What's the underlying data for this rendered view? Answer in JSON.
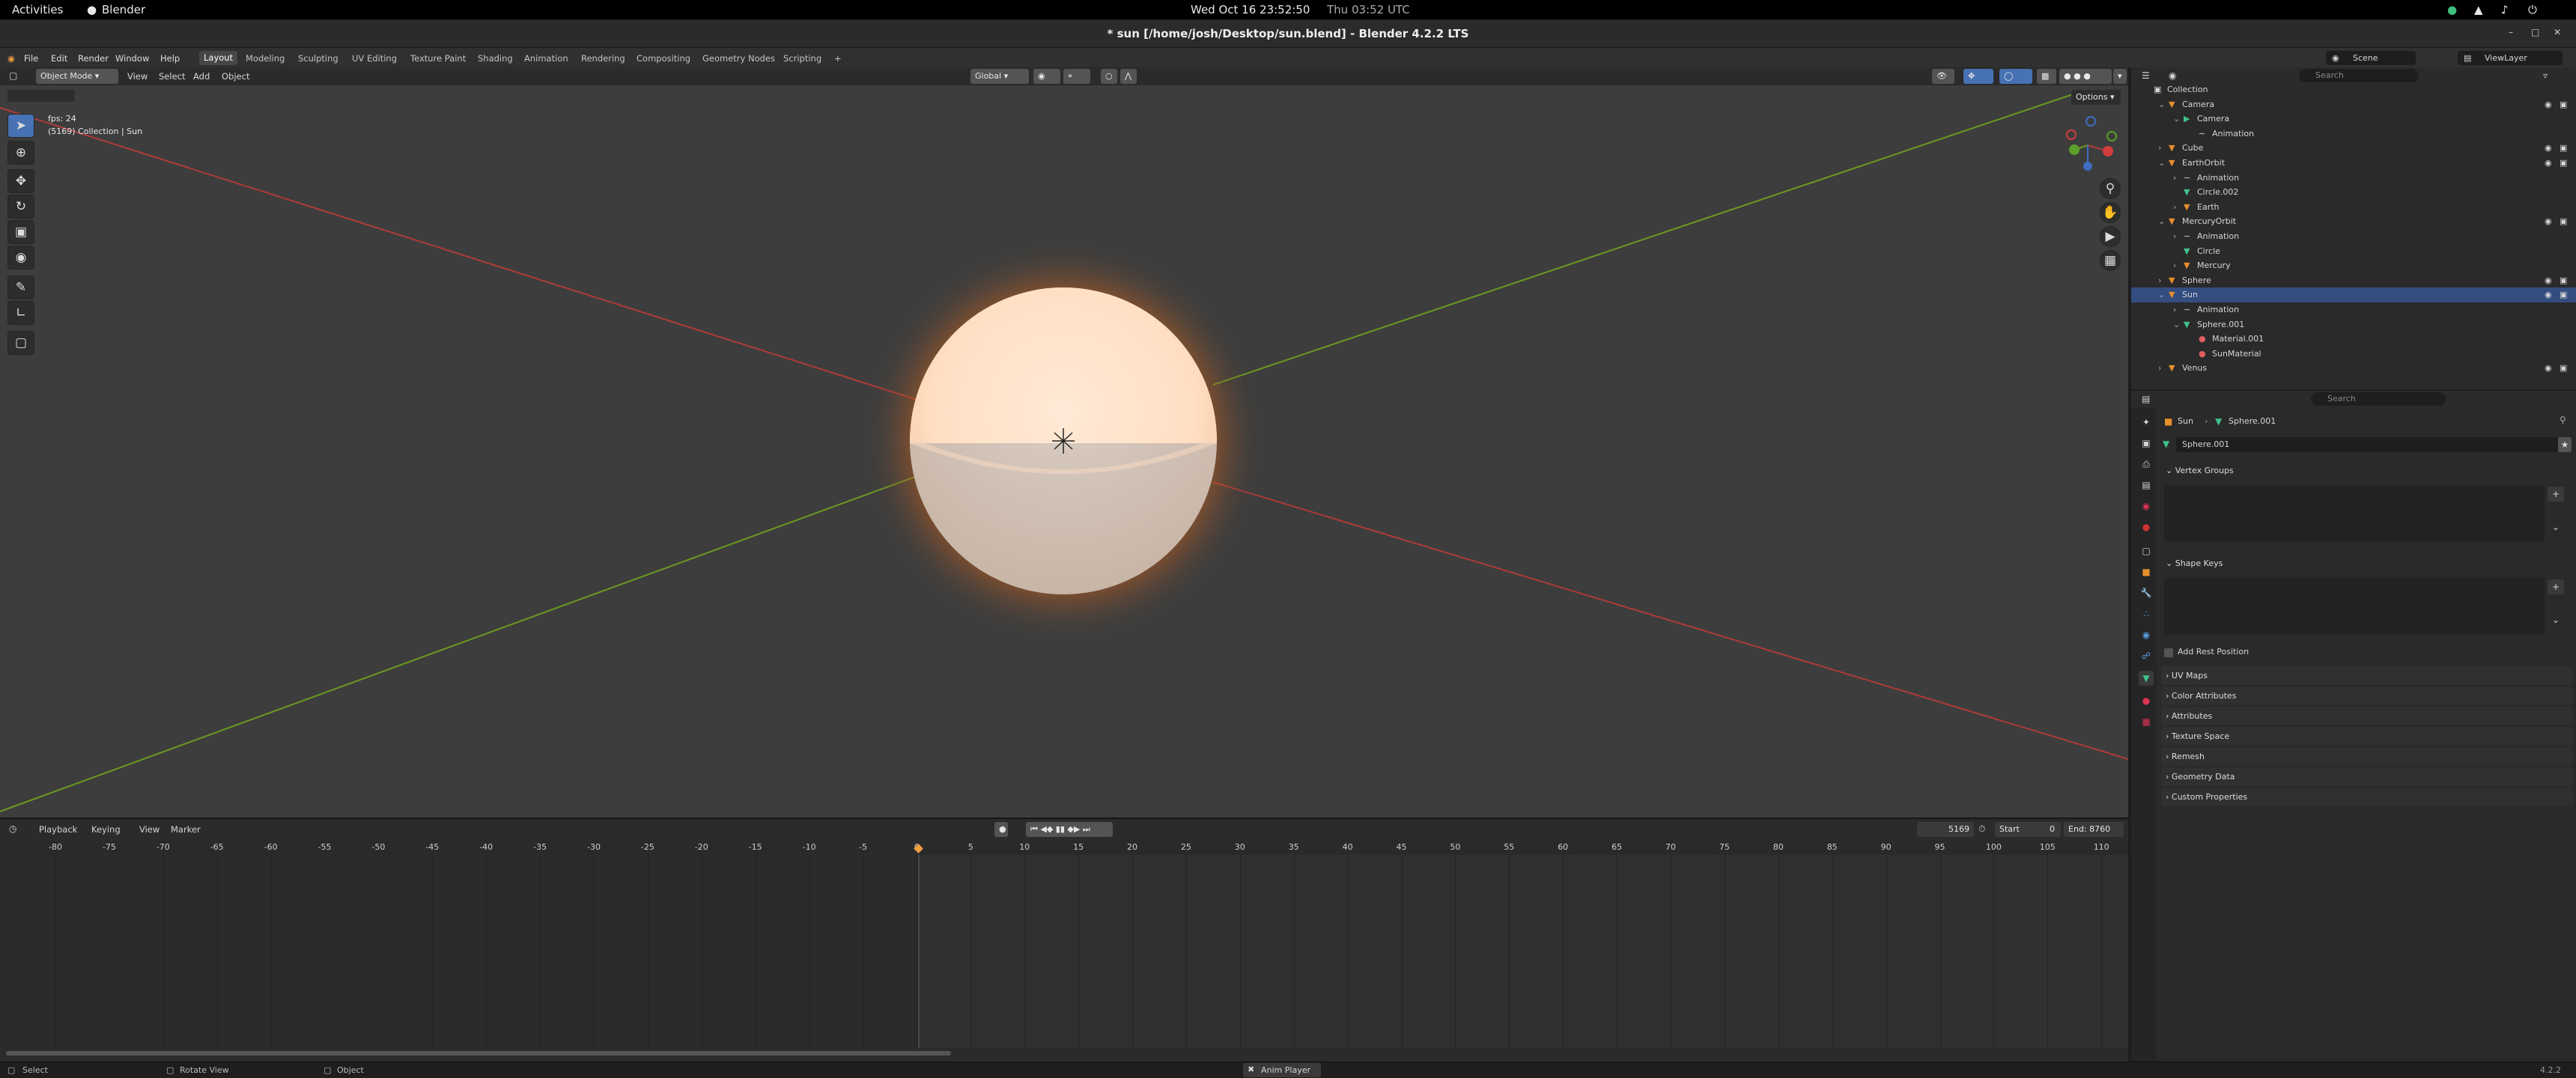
{
  "gnome_bar": {
    "activities": "Activities",
    "app_name": "Blender",
    "datetime": "Wed Oct 16  23:52:50",
    "utc_time": "Thu 03:52 UTC"
  },
  "window": {
    "title": "* sun [/home/josh/Desktop/sun.blend] - Blender 4.2.2 LTS"
  },
  "menu": {
    "items": [
      "File",
      "Edit",
      "Render",
      "Window",
      "Help"
    ],
    "workspaces": [
      "Layout",
      "Modeling",
      "Sculpting",
      "UV Editing",
      "Texture Paint",
      "Shading",
      "Animation",
      "Rendering",
      "Compositing",
      "Geometry Nodes",
      "Scripting"
    ],
    "active_workspace": "Layout",
    "add_workspace": "+",
    "scene": "Scene",
    "view_layer": "ViewLayer"
  },
  "viewport_header": {
    "mode": "Object Mode",
    "menus": [
      "View",
      "Select",
      "Add",
      "Object"
    ],
    "orientation": "Global",
    "options": "Options"
  },
  "viewport": {
    "overlay_line1": "fps: 24",
    "overlay_line2": "(5169) Collection | Sun"
  },
  "outliner": {
    "search_placeholder": "Search",
    "rows": [
      {
        "label": "Collection",
        "indent": 0,
        "type": "collection"
      },
      {
        "label": "Camera",
        "indent": 1,
        "type": "object",
        "expand": "v"
      },
      {
        "label": "Camera",
        "indent": 2,
        "type": "camera",
        "expand": "v"
      },
      {
        "label": "Animation",
        "indent": 3,
        "type": "anim"
      },
      {
        "label": "Cube",
        "indent": 1,
        "type": "object",
        "expand": ">"
      },
      {
        "label": "EarthOrbit",
        "indent": 1,
        "type": "object",
        "expand": "v"
      },
      {
        "label": "Animation",
        "indent": 2,
        "type": "anim",
        "expand": ">"
      },
      {
        "label": "Circle.002",
        "indent": 2,
        "type": "mesh"
      },
      {
        "label": "Earth",
        "indent": 2,
        "type": "object",
        "expand": ">"
      },
      {
        "label": "MercuryOrbit",
        "indent": 1,
        "type": "object",
        "expand": "v"
      },
      {
        "label": "Animation",
        "indent": 2,
        "type": "anim",
        "expand": ">"
      },
      {
        "label": "Circle",
        "indent": 2,
        "type": "mesh"
      },
      {
        "label": "Mercury",
        "indent": 2,
        "type": "object",
        "expand": ">"
      },
      {
        "label": "Sphere",
        "indent": 1,
        "type": "object",
        "expand": ">"
      },
      {
        "label": "Sun",
        "indent": 1,
        "type": "object",
        "expand": "v",
        "selected": true
      },
      {
        "label": "Animation",
        "indent": 2,
        "type": "anim",
        "expand": ">"
      },
      {
        "label": "Sphere.001",
        "indent": 2,
        "type": "mesh",
        "expand": "v"
      },
      {
        "label": "Material.001",
        "indent": 3,
        "type": "material"
      },
      {
        "label": "SunMaterial",
        "indent": 3,
        "type": "material"
      },
      {
        "label": "Venus",
        "indent": 1,
        "type": "object",
        "expand": ">"
      }
    ]
  },
  "properties": {
    "search_placeholder": "Search",
    "breadcrumb_object": "Sun",
    "breadcrumb_data": "Sphere.001",
    "data_name": "Sphere.001",
    "vertex_groups": "Vertex Groups",
    "shape_keys": "Shape Keys",
    "add_rest_position": "Add Rest Position",
    "panels": [
      "UV Maps",
      "Color Attributes",
      "Attributes",
      "Texture Space",
      "Remesh",
      "Geometry Data",
      "Custom Properties"
    ]
  },
  "timeline": {
    "menus": [
      "Playback",
      "Keying",
      "View",
      "Marker"
    ],
    "current_frame": "5169",
    "start_label": "Start",
    "start_value": "0",
    "end_label": "End",
    "end_value": "8760",
    "ticks": [
      "-80",
      "-75",
      "-70",
      "-65",
      "-60",
      "-55",
      "-50",
      "-45",
      "-40",
      "-35",
      "-30",
      "-25",
      "-20",
      "-15",
      "-10",
      "-5",
      "0",
      "5",
      "10",
      "15",
      "20",
      "25",
      "30",
      "35",
      "40",
      "45",
      "50",
      "55",
      "60",
      "65",
      "70",
      "75",
      "80",
      "85",
      "90",
      "95",
      "100",
      "105",
      "110"
    ]
  },
  "statusbar": {
    "select": "Select",
    "rotate_view": "Rotate View",
    "object": "Object",
    "anim_player": "Anim Player",
    "version": "4.2.2"
  },
  "colors": {
    "accent": "#4772b3",
    "selection": "#334d80",
    "x_axis": "#b03a3a",
    "y_axis": "#6a9a22",
    "object_orange": "#e8902d",
    "mesh_green": "#41c28c"
  }
}
